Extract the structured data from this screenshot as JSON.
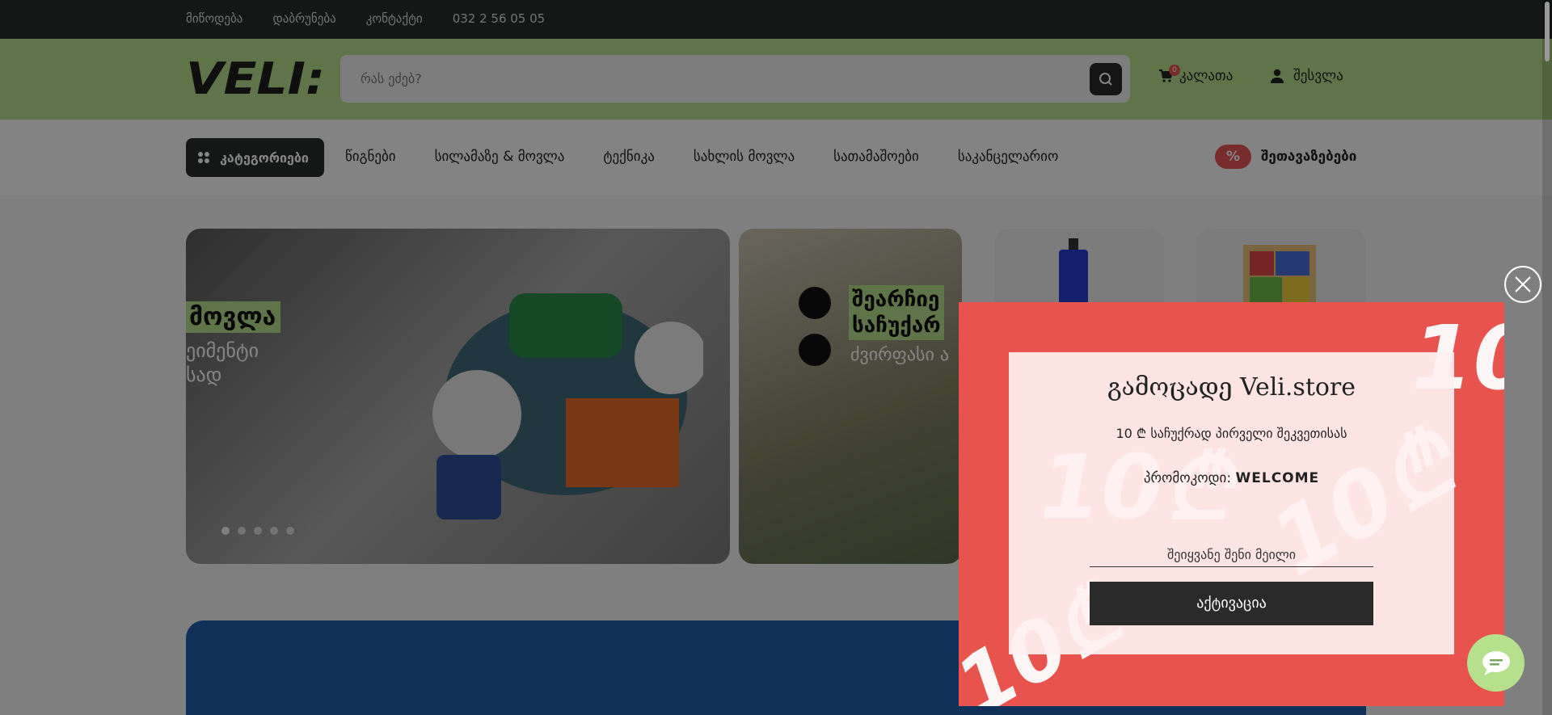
{
  "topbar": {
    "links": [
      "მიწოდება",
      "დაბრუნება",
      "კონტაქტი",
      "032 2 56 05 05"
    ]
  },
  "header": {
    "logo": "VELI:",
    "search_placeholder": "რას ეძებ?",
    "cart_label": "კალათა",
    "cart_count": "0",
    "login_label": "შესვლა"
  },
  "nav": {
    "categories_label": "კატეგორიები",
    "items": [
      "წიგნები",
      "სილამაზე & მოვლა",
      "ტექნიკა",
      "სახლის მოვლა",
      "სათამაშოები",
      "საკანცელარიო"
    ],
    "offers_label": "შეთავაზებები",
    "offers_icon": "%"
  },
  "banners": {
    "b1_title": "მოვლა",
    "b1_sub1": "ეიმენტი",
    "b1_sub2": "სად",
    "b2_title1": "შეარჩიე",
    "b2_title2": "საჩუქარ",
    "b2_sub": "ძვირფასი ა"
  },
  "popup": {
    "title": "გამოცადე Veli.store",
    "subtitle": "10 ₾ საჩუქრად პირველი შეკვეთისას",
    "promo_label": "პრომოკოდი:",
    "promo_code": "WELCOME",
    "email_placeholder": "შეიყვანე შენი მეილი",
    "button_label": "აქტივაცია",
    "decor_text": "10₾"
  },
  "colors": {
    "accent_green": "#b7e08d",
    "popup_red": "#e8534e",
    "dark": "#2a2c2b"
  }
}
